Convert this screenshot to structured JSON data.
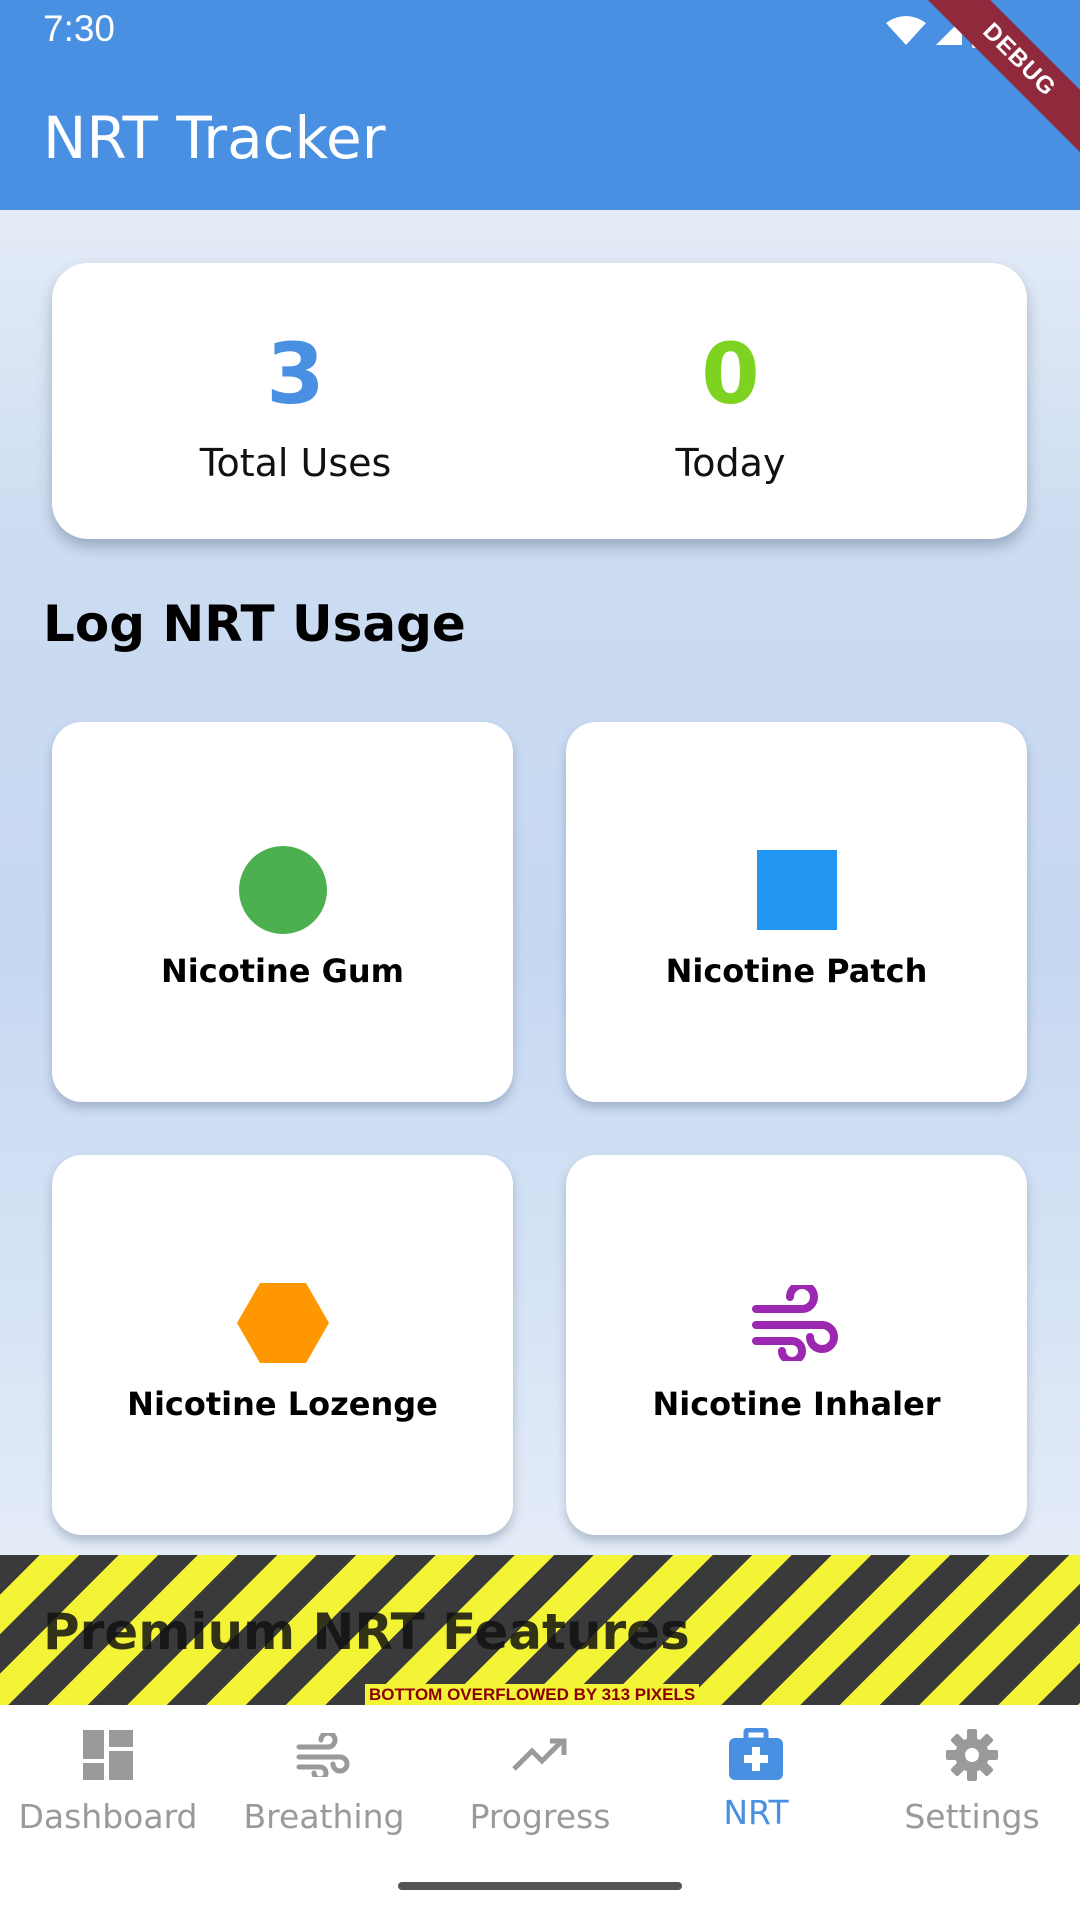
{
  "status_bar": {
    "time": "7:30",
    "debug_label": "DEBUG"
  },
  "app_bar": {
    "title": "NRT Tracker"
  },
  "stats": {
    "total": {
      "value": "3",
      "label": "Total Uses",
      "color": "#4A90E2"
    },
    "today": {
      "value": "0",
      "label": "Today",
      "color": "#7ED321"
    }
  },
  "log_section": {
    "title": "Log NRT Usage"
  },
  "tiles": [
    {
      "label": "Nicotine Gum",
      "icon": "circle-icon",
      "color": "#4CAF50"
    },
    {
      "label": "Nicotine Patch",
      "icon": "square-icon",
      "color": "#2196F3"
    },
    {
      "label": "Nicotine Lozenge",
      "icon": "hexagon-icon",
      "color": "#FF9800"
    },
    {
      "label": "Nicotine Inhaler",
      "icon": "wind-icon",
      "color": "#9C27B0"
    }
  ],
  "overflow": {
    "hidden_heading": "Premium NRT Features",
    "warning": "BOTTOM OVERFLOWED BY 313 PIXELS"
  },
  "bottom_nav": {
    "active_color": "#4A90E2",
    "inactive_color": "#9A9A9A",
    "items": [
      {
        "label": "Dashboard",
        "icon": "dashboard-icon",
        "active": false
      },
      {
        "label": "Breathing",
        "icon": "air-icon",
        "active": false
      },
      {
        "label": "Progress",
        "icon": "trending-up-icon",
        "active": false
      },
      {
        "label": "NRT",
        "icon": "medical-kit-icon",
        "active": true
      },
      {
        "label": "Settings",
        "icon": "gear-icon",
        "active": false
      }
    ]
  }
}
